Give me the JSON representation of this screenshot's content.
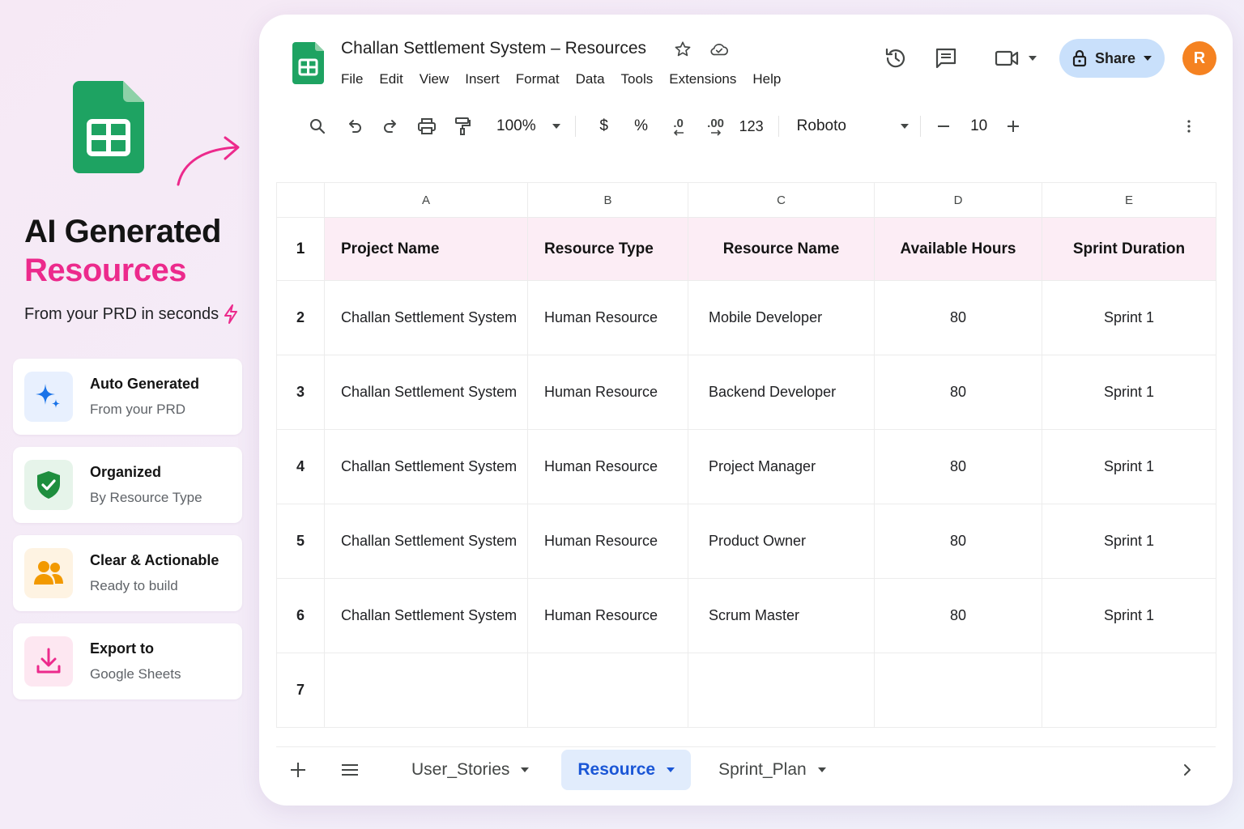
{
  "promo": {
    "headline_line1": "AI Generated",
    "headline_line2": "Resources",
    "subtitle": "From your PRD in seconds",
    "features": [
      {
        "title": "Auto Generated",
        "subtitle": "From your PRD",
        "icon": "sparkle-icon",
        "bg": "#e8f0fe",
        "color": "#1a73e8"
      },
      {
        "title": "Organized",
        "subtitle": "By Resource Type",
        "icon": "shield-check-icon",
        "bg": "#e6f4ea",
        "color": "#1e8e3e"
      },
      {
        "title": "Clear & Actionable",
        "subtitle": "Ready to build",
        "icon": "users-icon",
        "bg": "#fef3e2",
        "color": "#f29900"
      },
      {
        "title": "Export to",
        "subtitle": "Google Sheets",
        "icon": "download-icon",
        "bg": "#fde7f1",
        "color": "#ec2a8c"
      }
    ]
  },
  "doc": {
    "title": "Challan Settlement System – Resources",
    "menu": [
      "File",
      "Edit",
      "View",
      "Insert",
      "Format",
      "Data",
      "Tools",
      "Extensions",
      "Help"
    ],
    "share_label": "Share",
    "avatar_letter": "R"
  },
  "toolbar": {
    "zoom": "100%",
    "currency": "$",
    "percent": "%",
    "decrease_decimal": ".0",
    "increase_decimal": ".00",
    "number_format": "123",
    "font": "Roboto",
    "font_size": "10"
  },
  "sheet": {
    "column_letters": [
      "A",
      "B",
      "C",
      "D",
      "E"
    ],
    "row_numbers": [
      "1",
      "2",
      "3",
      "4",
      "5",
      "6",
      "7"
    ],
    "headers": [
      "Project Name",
      "Resource Type",
      "Resource Name",
      "Available Hours",
      "Sprint Duration"
    ],
    "rows": [
      [
        "Challan Settlement System",
        "Human Resource",
        "Mobile Developer",
        "80",
        "Sprint 1"
      ],
      [
        "Challan Settlement System",
        "Human Resource",
        "Backend Developer",
        "80",
        "Sprint 1"
      ],
      [
        "Challan Settlement System",
        "Human Resource",
        "Project Manager",
        "80",
        "Sprint 1"
      ],
      [
        "Challan Settlement System",
        "Human Resource",
        "Product Owner",
        "80",
        "Sprint 1"
      ],
      [
        "Challan Settlement System",
        "Human Resource",
        "Scrum Master",
        "80",
        "Sprint 1"
      ],
      [
        "",
        "",
        "",
        "",
        ""
      ]
    ]
  },
  "tabs": [
    {
      "label": "User_Stories",
      "active": false
    },
    {
      "label": "Resource",
      "active": true
    },
    {
      "label": "Sprint_Plan",
      "active": false
    }
  ],
  "colors": {
    "brand_green": "#1ea362",
    "accent_pink": "#ec2a8c",
    "share_bg": "#c9e0fb",
    "active_tab": "#1a56d6",
    "header_row_bg": "#fcedf5"
  }
}
